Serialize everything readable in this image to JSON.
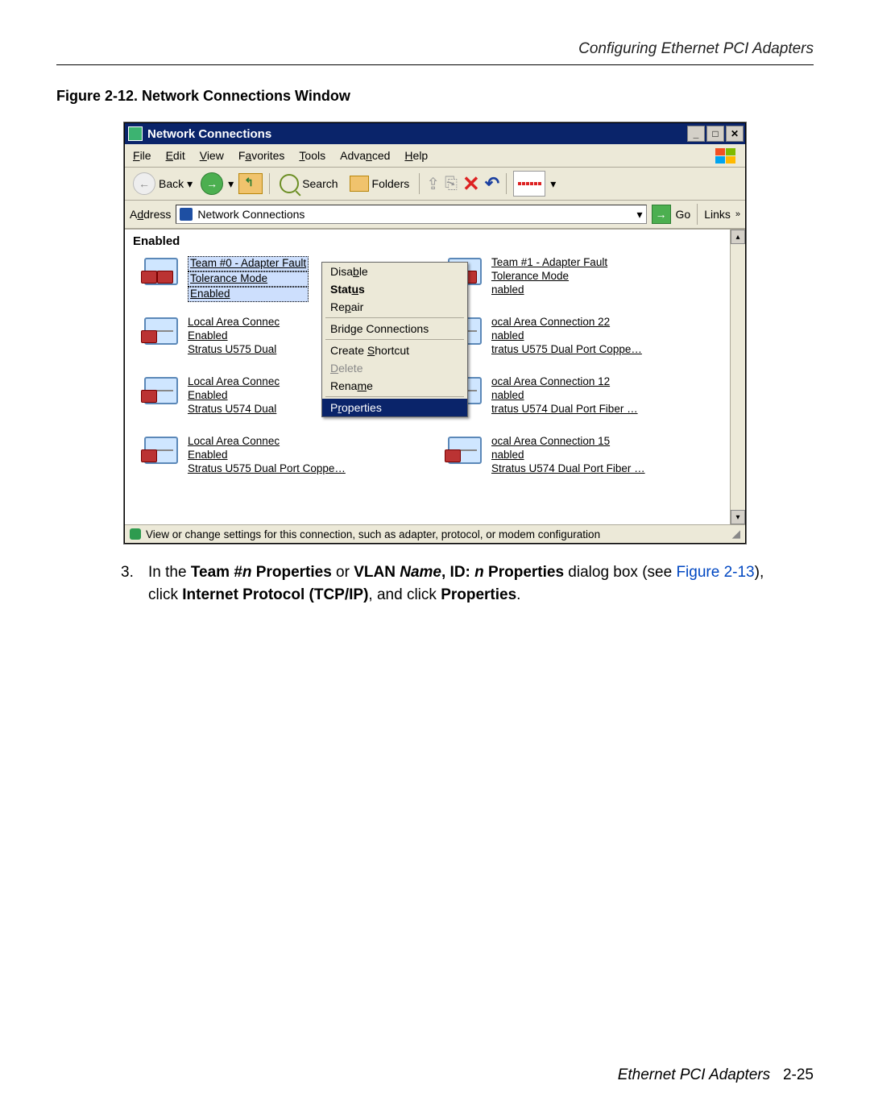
{
  "page_header": "Configuring Ethernet PCI Adapters",
  "figure_caption": "Figure 2-12. Network Connections Window",
  "footer_label": "Ethernet PCI Adapters",
  "footer_page": "2-25",
  "instruction": {
    "num": "3.",
    "pre": "In the ",
    "b1": "Team #",
    "bi1": "n",
    "b2": " Properties",
    "mid1": " or ",
    "b3": "VLAN ",
    "bi2": "Name",
    "b4": ", ID: ",
    "bi3": "n",
    "b5": " Properties",
    "mid2": " dialog box (see ",
    "link": "Figure 2-13",
    "mid3": "), click ",
    "b6": "Internet Protocol (TCP/IP)",
    "mid4": ", and click ",
    "b7": "Properties",
    "end": "."
  },
  "window": {
    "title": "Network Connections",
    "menus": [
      "File",
      "Edit",
      "View",
      "Favorites",
      "Tools",
      "Advanced",
      "Help"
    ],
    "toolbar": {
      "back": "Back",
      "search": "Search",
      "folders": "Folders"
    },
    "address": {
      "label": "Address",
      "value": "Network Connections",
      "go": "Go",
      "links": "Links"
    },
    "group_header": "Enabled",
    "context_menu": [
      "Disable",
      "Status",
      "Repair",
      "Bridge Connections",
      "Create Shortcut",
      "Delete",
      "Rename",
      "Properties"
    ],
    "statusbar": "View or change settings for this connection, such as adapter, protocol, or modem configuration",
    "items_left": [
      {
        "l1": "Team #0 - Adapter Fault",
        "l2": "Tolerance Mode",
        "l3": "Enabled"
      },
      {
        "l1": "Local Area Connec",
        "l2": "Enabled",
        "l3": "Stratus U575 Dual"
      },
      {
        "l1": "Local Area Connec",
        "l2": "Enabled",
        "l3": "Stratus U574 Dual"
      },
      {
        "l1": "Local Area Connec",
        "l2": "Enabled",
        "l3": "Stratus U575 Dual Port Coppe…"
      }
    ],
    "items_right": [
      {
        "l1": "Team #1 - Adapter Fault",
        "l2": "Tolerance Mode",
        "l3": "nabled"
      },
      {
        "l1": "ocal Area Connection 22",
        "l2": "nabled",
        "l3": "tratus U575 Dual Port Coppe…"
      },
      {
        "l1": "ocal Area Connection 12",
        "l2": "nabled",
        "l3": "tratus U574 Dual Port Fiber …"
      },
      {
        "l1": "ocal Area Connection 15",
        "l2": "nabled",
        "l3": "Stratus U574 Dual Port Fiber …"
      }
    ]
  }
}
